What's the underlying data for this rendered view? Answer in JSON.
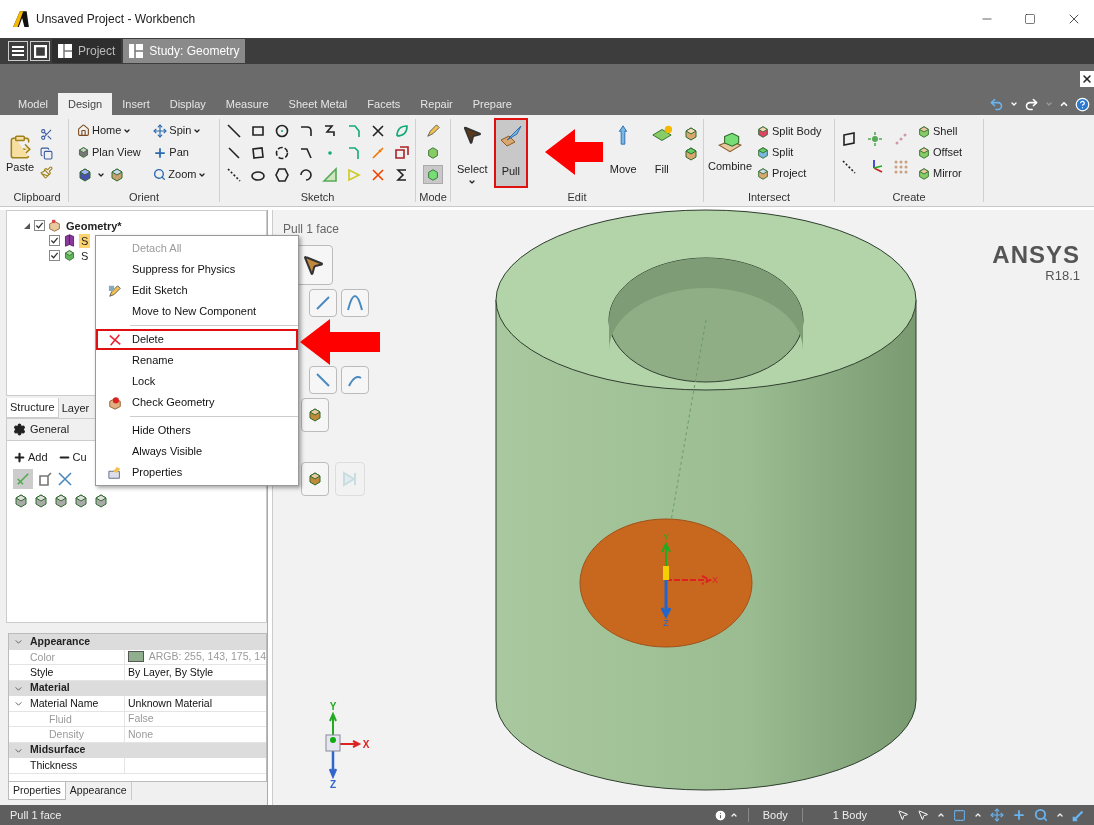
{
  "window": {
    "title": "Unsaved Project - Workbench"
  },
  "doc_tabs": [
    {
      "label": "Project",
      "selected": false
    },
    {
      "label": "Study: Geometry",
      "selected": true
    }
  ],
  "ribbon": {
    "tabs": [
      {
        "label": "Model",
        "selected": false
      },
      {
        "label": "Design",
        "selected": true
      },
      {
        "label": "Insert",
        "selected": false
      },
      {
        "label": "Display",
        "selected": false
      },
      {
        "label": "Measure",
        "selected": false
      },
      {
        "label": "Sheet Metal",
        "selected": false
      },
      {
        "label": "Facets",
        "selected": false
      },
      {
        "label": "Repair",
        "selected": false
      },
      {
        "label": "Prepare",
        "selected": false
      }
    ],
    "clipboard": {
      "label": "Clipboard",
      "paste": "Paste"
    },
    "orient": {
      "label": "Orient",
      "buttons": [
        "Home",
        "Spin",
        "Plan View",
        "Pan",
        "Zoom"
      ]
    },
    "sketch": {
      "label": "Sketch"
    },
    "mode": {
      "label": "Mode",
      "modes": [
        {
          "selected": false
        },
        {
          "selected": false
        },
        {
          "selected": true
        }
      ]
    },
    "edit": {
      "label": "Edit",
      "buttons": [
        {
          "label": "Select",
          "selected": false,
          "highlighted": false
        },
        {
          "label": "Pull",
          "selected": true,
          "highlighted": true
        },
        {
          "label": "Move",
          "selected": false,
          "highlighted": false
        },
        {
          "label": "Fill",
          "selected": false,
          "highlighted": false
        }
      ]
    },
    "intersect": {
      "label": "Intersect",
      "buttons": [
        "Combine",
        "Split Body",
        "Split",
        "Project"
      ]
    },
    "create": {
      "label": "Create",
      "buttons": [
        "Shell",
        "Offset",
        "Mirror"
      ]
    }
  },
  "structure": {
    "tree": [
      {
        "label": "Geometry*",
        "checked": true,
        "selected": false,
        "expanded": true,
        "children": [
          {
            "label": "S",
            "checked": true,
            "selected": true
          },
          {
            "label": "S",
            "checked": true,
            "selected": false
          }
        ]
      }
    ]
  },
  "panel_tabs": [
    {
      "label": "Structure",
      "selected": true
    },
    {
      "label": "Layer",
      "selected": false
    }
  ],
  "general": {
    "tab": "General",
    "add": "Add",
    "remove": "Cu"
  },
  "properties": {
    "groups": [
      {
        "label": "Appearance",
        "expanded": true,
        "rows": [
          {
            "name": "Color",
            "value": "ARGB: 255, 143, 175, 14",
            "color": "#8faf8f",
            "disabled": true
          },
          {
            "name": "Style",
            "value": "By Layer, By Style",
            "disabled": false
          }
        ]
      },
      {
        "label": "Material",
        "expanded": true,
        "rows": [
          {
            "name": "Material Name",
            "value": "Unknown Material",
            "disabled": false,
            "expanded": true,
            "children": [
              {
                "name": "Fluid",
                "value": "False",
                "disabled": true
              },
              {
                "name": "Density",
                "value": "None",
                "disabled": true
              }
            ]
          }
        ]
      },
      {
        "label": "Midsurface",
        "expanded": true,
        "rows": [
          {
            "name": "Thickness",
            "disabled": false
          }
        ]
      }
    ]
  },
  "bottom_tabs": [
    {
      "label": "Properties",
      "selected": true
    },
    {
      "label": "Appearance",
      "selected": false
    }
  ],
  "context_menu": [
    {
      "label": "Detach All",
      "disabled": true,
      "highlighted": false,
      "separator_before": false
    },
    {
      "label": "Suppress for Physics",
      "disabled": false,
      "highlighted": false,
      "separator_before": false
    },
    {
      "label": "Edit Sketch",
      "disabled": false,
      "highlighted": false,
      "separator_before": false
    },
    {
      "label": "Move to New Component",
      "disabled": false,
      "highlighted": false,
      "separator_before": false
    },
    {
      "label": "Delete",
      "disabled": false,
      "highlighted": true,
      "separator_before": true
    },
    {
      "label": "Rename",
      "disabled": false,
      "highlighted": false,
      "separator_before": false
    },
    {
      "label": "Lock",
      "disabled": false,
      "highlighted": false,
      "separator_before": false
    },
    {
      "label": "Check Geometry",
      "disabled": false,
      "highlighted": false,
      "separator_before": false
    },
    {
      "label": "Hide Others",
      "disabled": false,
      "highlighted": false,
      "separator_before": true
    },
    {
      "label": "Always Visible",
      "disabled": false,
      "highlighted": false,
      "separator_before": false
    },
    {
      "label": "Properties",
      "disabled": false,
      "highlighted": false,
      "separator_before": false
    }
  ],
  "viewport": {
    "hint": "Pull 1 face",
    "logo": "ANSYS",
    "version": "R18.1",
    "face_axes": [
      "Y",
      "X",
      "Z"
    ],
    "triad_axes": [
      "Y",
      "X",
      "Z"
    ]
  },
  "status_bar": {
    "message": "Pull 1 face",
    "selection_filter": "Body",
    "selection_count": "1 Body"
  }
}
